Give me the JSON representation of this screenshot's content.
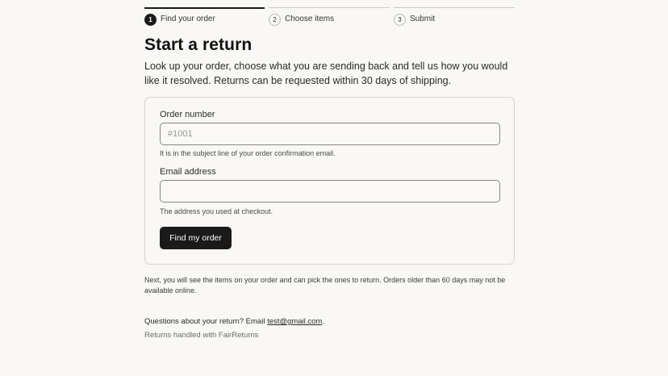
{
  "stepper": {
    "steps": [
      {
        "number": "1",
        "label": "Find your order"
      },
      {
        "number": "2",
        "label": "Choose items"
      },
      {
        "number": "3",
        "label": "Submit"
      }
    ]
  },
  "header": {
    "title": "Start a return",
    "intro": "Look up your order, choose what you are sending back and tell us how you would like it resolved. Returns can be requested within 30 days of shipping."
  },
  "form": {
    "order_number": {
      "label": "Order number",
      "placeholder": "#1001",
      "value": "",
      "hint": "It is in the subject line of your order confirmation email."
    },
    "email": {
      "label": "Email address",
      "placeholder": "",
      "value": "",
      "hint": "The address you used at checkout."
    },
    "submit_label": "Find my order"
  },
  "note": "Next, you will see the items on your order and can pick the ones to return. Orders older than 60 days may not be available online.",
  "footer": {
    "contact_prefix": "Questions about your return? Email ",
    "contact_email": "test@gmail.com",
    "contact_suffix": ".",
    "powered_by": "Returns handled with FairReturns"
  },
  "colors": {
    "background": "#f9f8f6",
    "button": "#1a1a1a",
    "text": "#1a1a1a"
  }
}
